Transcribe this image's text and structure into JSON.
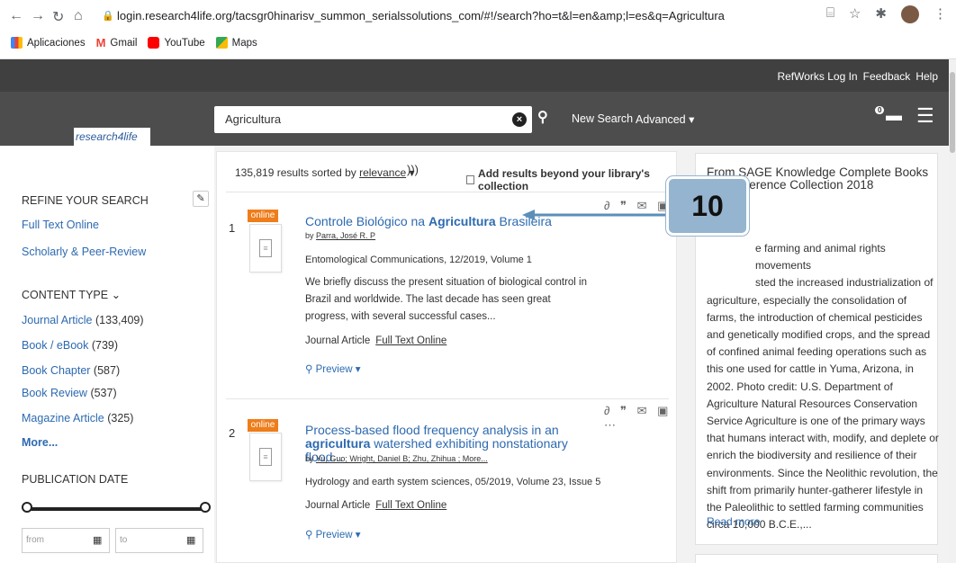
{
  "browser": {
    "url": "login.research4life.org/tacsgr0hinarisv_summon_serialssolutions_com/#!/search?ho=t&l=en&amp;l=es&q=Agricultura",
    "bookmarks": [
      "Aplicaciones",
      "Gmail",
      "YouTube",
      "Maps"
    ]
  },
  "topbar": {
    "refworks": "RefWorks Log In",
    "feedback": "Feedback",
    "help": "Help"
  },
  "header": {
    "logo_text": "research4life",
    "search_value": "Agricultura",
    "new_search": "New Search",
    "advanced": "Advanced",
    "folder_count": "0"
  },
  "sidebar": {
    "refine_heading": "REFINE YOUR SEARCH",
    "filters": [
      "Full Text Online",
      "Scholarly & Peer-Review"
    ],
    "content_type_heading": "CONTENT TYPE",
    "content_types": [
      {
        "label": "Journal Article",
        "count": "(133,409)"
      },
      {
        "label": "Book / eBook",
        "count": "(739)"
      },
      {
        "label": "Book Chapter",
        "count": "(587)"
      },
      {
        "label": "Book Review",
        "count": "(537)"
      },
      {
        "label": "Magazine Article",
        "count": "(325)"
      }
    ],
    "more": "More...",
    "pub_date_heading": "PUBLICATION DATE",
    "from_placeholder": "from",
    "to_placeholder": "to"
  },
  "results": {
    "summary": "135,819 results sorted by",
    "sort": "relevance",
    "beyond_label": "Add results beyond your library's collection",
    "items": [
      {
        "num": "1",
        "badge": "online",
        "title_pre": "Controle Biológico na ",
        "title_bold": "Agricultura",
        "title_post": " Brasileira",
        "by": "by",
        "authors": "Parra, José R. P",
        "source": "Entomological Communications, 12/2019, Volume 1",
        "abstract": "We briefly discuss the present situation of biological control in Brazil and worldwide. The last decade has seen great progress, with several successful cases...",
        "type": "Journal Article",
        "fulltext": "Full Text Online",
        "preview": "Preview"
      },
      {
        "num": "2",
        "badge": "online",
        "title_pre": "Process-based flood frequency analysis in an",
        "title_bold": "agricultura",
        "title_post": " watershed exhibiting nonstationary flood...",
        "by": "by",
        "authors": "Yu, Guo; Wright, Daniel B; Zhu, Zhihua ; More...",
        "source": "Hydrology and earth system sciences, 05/2019, Volume 23, Issue 5",
        "type": "Journal Article",
        "fulltext": "Full Text Online",
        "preview": "Preview"
      }
    ]
  },
  "card": {
    "title": "From SAGE Knowledge Complete Books and Reference Collection 2018",
    "text_first": "e farming and animal rights movements",
    "text_second": "sted the increased industrialization of",
    "text_rest": "agriculture, especially the consolidation of farms, the introduction of chemical pesticides and genetically modified crops, and the spread of confined animal feeding operations such as this one used for cattle in Yuma, Arizona, in 2002. Photo credit: U.S. Department of Agriculture Natural Resources Conservation Service Agriculture is one of the primary ways that humans interact with, modify, and deplete or enrich the biodiversity and resilience of their environments. Since the Neolithic revolution, the shift from primarily hunter-gatherer lifestyle in the Paleolithic to settled farming communities circa 10,000 B.C.E.,...",
    "read_more": "Read more"
  },
  "annotation": {
    "number": "10",
    "color": "#95b4cf"
  }
}
